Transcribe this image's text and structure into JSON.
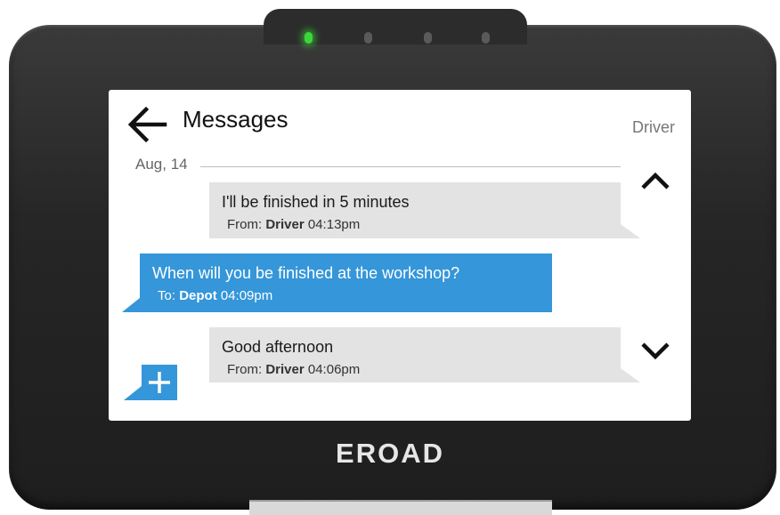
{
  "device": {
    "brand": "EROAD",
    "leds": [
      "on",
      "off",
      "off",
      "off"
    ],
    "led_on_color": "#3cd63c"
  },
  "header": {
    "title": "Messages",
    "user": "Driver"
  },
  "date_group": "Aug, 14",
  "messages": [
    {
      "direction": "incoming",
      "text": "I'll be finished in 5 minutes",
      "prefix": "From: ",
      "party": "Driver",
      "time": "04:13pm"
    },
    {
      "direction": "outgoing",
      "text": "When will you be finished at the workshop?",
      "prefix": "To: ",
      "party": "Depot",
      "time": "04:09pm"
    },
    {
      "direction": "incoming",
      "text": "Good afternoon",
      "prefix": "From: ",
      "party": "Driver",
      "time": "04:06pm"
    }
  ],
  "icons": {
    "back": "arrow-left-icon",
    "scroll_up": "chevron-up-icon",
    "scroll_down": "chevron-down-icon",
    "compose": "plus-icon"
  },
  "colors": {
    "outgoing_bubble": "#3596d9",
    "incoming_bubble": "#e3e3e3",
    "device_body": "#262626"
  }
}
